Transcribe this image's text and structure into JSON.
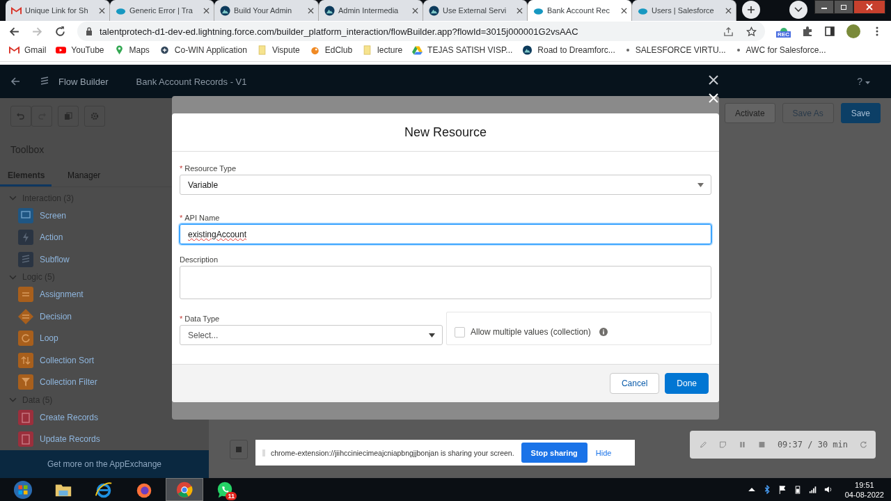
{
  "browser": {
    "tabs": [
      {
        "title": "Unique Link for Sh",
        "kind": "gmail",
        "selected": false
      },
      {
        "title": "Generic Error | Tra",
        "kind": "cloud",
        "selected": false
      },
      {
        "title": "Build Your Admin",
        "kind": "mountain",
        "selected": false
      },
      {
        "title": "Admin Intermedia",
        "kind": "mountain",
        "selected": false
      },
      {
        "title": "Use External Servi",
        "kind": "mountain",
        "selected": false
      },
      {
        "title": "Bank Account Rec",
        "kind": "cloud",
        "selected": true
      },
      {
        "title": "Users | Salesforce",
        "kind": "cloud",
        "selected": false
      }
    ],
    "url": "talentprotech-d1-dev-ed.lightning.force.com/builder_platform_interaction/flowBuilder.app?flowId=3015j000001G2vsAAC",
    "extension_badge": "REC",
    "bookmarks": [
      {
        "label": "Gmail",
        "kind": "gmail"
      },
      {
        "label": "YouTube",
        "kind": "youtube"
      },
      {
        "label": "Maps",
        "kind": "pin"
      },
      {
        "label": "Co-WIN Application",
        "kind": "plus"
      },
      {
        "label": "Vispute",
        "kind": "folder"
      },
      {
        "label": "EdClub",
        "kind": "bird"
      },
      {
        "label": "lecture",
        "kind": "folder"
      },
      {
        "label": "TEJAS SATISH VISP...",
        "kind": "drive"
      },
      {
        "label": "Road to Dreamforc...",
        "kind": "mountain"
      },
      {
        "label": "SALESFORCE VIRTU...",
        "kind": "dot"
      },
      {
        "label": "AWC for Salesforce...",
        "kind": "dot"
      }
    ]
  },
  "app": {
    "title": "Flow Builder",
    "flow_name": "Bank Account Records - V1",
    "help": "?",
    "toolbar_buttons": [
      {
        "label": "Activate",
        "kind": "plain",
        "disabled": true
      },
      {
        "label": "Save As",
        "kind": "plain",
        "disabled": false
      },
      {
        "label": "Save",
        "kind": "brand",
        "disabled": false
      }
    ],
    "toolbox": {
      "title": "Toolbox",
      "tabs": [
        {
          "label": "Elements",
          "selected": true
        },
        {
          "label": "Manager",
          "selected": false
        }
      ],
      "sections": [
        {
          "label": "Interaction (3)",
          "expanded": true,
          "children": [
            {
              "label": "Screen",
              "kind": "screen",
              "color": "#1f5683"
            },
            {
              "label": "Action",
              "kind": "action",
              "color": "#2a3442"
            },
            {
              "label": "Subflow",
              "kind": "subflow",
              "color": "#2a3442"
            }
          ]
        },
        {
          "label": "Logic (5)",
          "expanded": true,
          "children": [
            {
              "label": "Assignment",
              "kind": "assignment",
              "color": "#a85f1c"
            },
            {
              "label": "Decision",
              "kind": "decision",
              "color": "#a85f1c"
            },
            {
              "label": "Loop",
              "kind": "loop",
              "color": "#a85f1c"
            },
            {
              "label": "Collection Sort",
              "kind": "sort",
              "color": "#a85f1c"
            },
            {
              "label": "Collection Filter",
              "kind": "filter",
              "color": "#a85f1c"
            }
          ]
        },
        {
          "label": "Data (5)",
          "expanded": true,
          "children": [
            {
              "label": "Create Records",
              "kind": "create",
              "color": "#9b2f3c"
            },
            {
              "label": "Update Records",
              "kind": "update",
              "color": "#9b2f3c"
            }
          ]
        }
      ]
    },
    "appexchange": "Get more on the AppExchange"
  },
  "modal": {
    "title": "New Resource",
    "fields": [
      {
        "kind": "select",
        "label": "Resource Type",
        "required_mark": "*",
        "value": "Variable",
        "focused": false
      },
      {
        "kind": "text",
        "label": "API Name",
        "required_mark": "*",
        "value": "existingAccount",
        "focused": true
      },
      {
        "kind": "textarea",
        "label": "Description",
        "focused": false
      }
    ],
    "data_type": {
      "label": "Data Type",
      "required_mark": "*",
      "placeholder": "Select..."
    },
    "collection": {
      "label": "Allow multiple values (collection)",
      "checked": false
    },
    "buttons": [
      {
        "label": "Cancel",
        "kind": "neutral"
      },
      {
        "label": "Done",
        "kind": "brand"
      }
    ]
  },
  "screen_share": {
    "message": "chrome-extension://jiihcciniecimeajcniapbngjjbonjan is sharing your screen.",
    "stop": "Stop sharing",
    "hide": "Hide"
  },
  "recorder": {
    "time": "09:37 / 30 min"
  },
  "taskbar": {
    "apps": [
      {
        "kind": "start",
        "active": false
      },
      {
        "kind": "folder",
        "active": false
      },
      {
        "kind": "ie",
        "active": false
      },
      {
        "kind": "firefox",
        "active": false
      },
      {
        "kind": "chrome",
        "active": true
      },
      {
        "kind": "whatsapp",
        "active": false,
        "badge": "11"
      }
    ],
    "time": "19:51",
    "date": "04-08-2022"
  }
}
